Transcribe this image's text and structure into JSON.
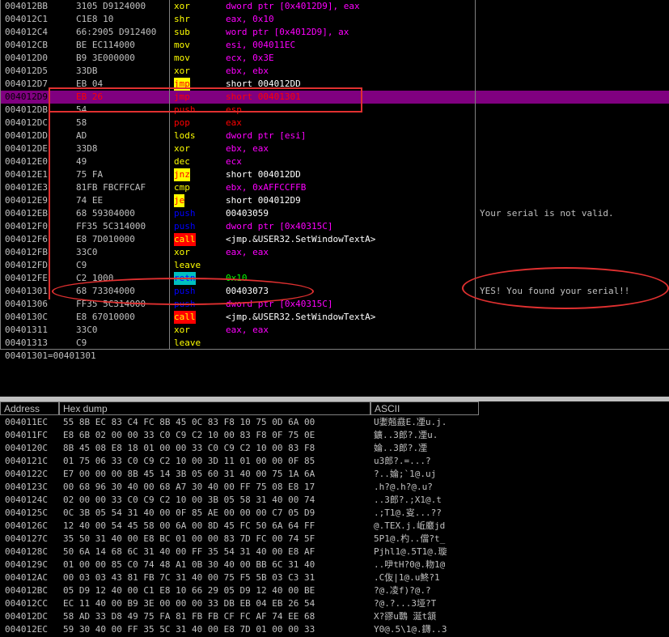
{
  "colors": {
    "selection": "#800080",
    "annotation": "#e03030",
    "jump_bg": "#ffff00",
    "call_bg": "#ff0000",
    "retn_bg": "#00c0c0"
  },
  "disasm_rows": [
    {
      "addr": "004012BB",
      "hex": "3105 D9124000",
      "mn": "xor",
      "op": "dword ptr [0x4012D9], eax",
      "mn_cls": "plain",
      "op_cls": "mixed",
      "cm": ""
    },
    {
      "addr": "004012C1",
      "hex": "C1E8 10",
      "mn": "shr",
      "op": "eax, 0x10",
      "mn_cls": "plain",
      "op_cls": "mixed",
      "cm": ""
    },
    {
      "addr": "004012C4",
      "hex": "66:2905 D912400",
      "mn": "sub",
      "op": "word ptr [0x4012D9], ax",
      "mn_cls": "plain",
      "op_cls": "mixed",
      "cm": ""
    },
    {
      "addr": "004012CB",
      "hex": "BE EC114000",
      "mn": "mov",
      "op": "esi, 004011EC",
      "mn_cls": "plain",
      "op_cls": "mixed",
      "cm": ""
    },
    {
      "addr": "004012D0",
      "hex": "B9 3E000000",
      "mn": "mov",
      "op": "ecx, 0x3E",
      "mn_cls": "plain",
      "op_cls": "mixed",
      "cm": ""
    },
    {
      "addr": "004012D5",
      "hex": "33DB",
      "mn": "xor",
      "op": "ebx, ebx",
      "mn_cls": "plain",
      "op_cls": "mixed",
      "cm": ""
    },
    {
      "addr": "004012D7",
      "hex": "EB 04",
      "mn": "jmp",
      "op": "short 004012DD",
      "mn_cls": "jump",
      "op_cls": "white",
      "cm": ""
    },
    {
      "addr": "004012D9",
      "hex": "EB 26",
      "mn": "jmp",
      "op": "short 00401301",
      "mn_cls": "red",
      "op_cls": "red",
      "cm": "",
      "sel": true
    },
    {
      "addr": "004012DB",
      "hex": "54",
      "mn": "push",
      "op": "esp",
      "mn_cls": "red",
      "op_cls": "red",
      "cm": ""
    },
    {
      "addr": "004012DC",
      "hex": "58",
      "mn": "pop",
      "op": "eax",
      "mn_cls": "red",
      "op_cls": "red",
      "cm": ""
    },
    {
      "addr": "004012DD",
      "hex": "AD",
      "mn": "lods",
      "op": "dword ptr [esi]",
      "mn_cls": "plain",
      "op_cls": "mixed",
      "cm": ""
    },
    {
      "addr": "004012DE",
      "hex": "33D8",
      "mn": "xor",
      "op": "ebx, eax",
      "mn_cls": "plain",
      "op_cls": "mixed",
      "cm": ""
    },
    {
      "addr": "004012E0",
      "hex": "49",
      "mn": "dec",
      "op": "ecx",
      "mn_cls": "plain",
      "op_cls": "mixed",
      "cm": ""
    },
    {
      "addr": "004012E1",
      "hex": "75 FA",
      "mn": "jnz",
      "op": "short 004012DD",
      "mn_cls": "jump",
      "op_cls": "white",
      "cm": ""
    },
    {
      "addr": "004012E3",
      "hex": "81FB FBCFFCAF",
      "mn": "cmp",
      "op": "ebx, 0xAFFCCFFB",
      "mn_cls": "plain",
      "op_cls": "mixed",
      "cm": ""
    },
    {
      "addr": "004012E9",
      "hex": "74 EE",
      "mn": "je",
      "op": "short 004012D9",
      "mn_cls": "jump",
      "op_cls": "white",
      "cm": ""
    },
    {
      "addr": "004012EB",
      "hex": "68 59304000",
      "mn": "push",
      "op": "00403059",
      "mn_cls": "push",
      "op_cls": "white",
      "cm": "Your serial is not valid."
    },
    {
      "addr": "004012F0",
      "hex": "FF35 5C314000",
      "mn": "push",
      "op": "dword ptr [0x40315C]",
      "mn_cls": "push",
      "op_cls": "mixed",
      "cm": ""
    },
    {
      "addr": "004012F6",
      "hex": "E8 7D010000",
      "mn": "call",
      "op": "<jmp.&USER32.SetWindowTextA>",
      "mn_cls": "call",
      "op_cls": "white",
      "cm": ""
    },
    {
      "addr": "004012FB",
      "hex": "33C0",
      "mn": "xor",
      "op": "eax, eax",
      "mn_cls": "plain",
      "op_cls": "mixed",
      "cm": ""
    },
    {
      "addr": "004012FD",
      "hex": "C9",
      "mn": "leave",
      "op": "",
      "mn_cls": "plain",
      "op_cls": "mixed",
      "cm": ""
    },
    {
      "addr": "004012FE",
      "hex": "C2 1000",
      "mn": "retn",
      "op": "0x10",
      "mn_cls": "retn",
      "op_cls": "green",
      "cm": ""
    },
    {
      "addr": "00401301",
      "hex": "68 73304000",
      "mn": "push",
      "op": "00403073",
      "mn_cls": "push",
      "op_cls": "white",
      "cm": "YES! You found your serial!!"
    },
    {
      "addr": "00401306",
      "hex": "FF35 5C314000",
      "mn": "push",
      "op": "dword ptr [0x40315C]",
      "mn_cls": "push",
      "op_cls": "mixed",
      "cm": ""
    },
    {
      "addr": "0040130C",
      "hex": "E8 67010000",
      "mn": "call",
      "op": "<jmp.&USER32.SetWindowTextA>",
      "mn_cls": "call",
      "op_cls": "white",
      "cm": ""
    },
    {
      "addr": "00401311",
      "hex": "33C0",
      "mn": "xor",
      "op": "eax, eax",
      "mn_cls": "plain",
      "op_cls": "mixed",
      "cm": ""
    },
    {
      "addr": "00401313",
      "hex": "C9",
      "mn": "leave",
      "op": "",
      "mn_cls": "plain",
      "op_cls": "mixed",
      "cm": ""
    }
  ],
  "info_line": "00401301=00401301",
  "dump_headers": {
    "address": "Address",
    "hex": "Hex dump",
    "ascii": "ASCII"
  },
  "dump_rows": [
    {
      "addr": "004011EC",
      "hex": "55 8B EC 83 C4 FC 8B 45 0C 83 F8 10 75 0D 6A 00",
      "asc": "U嬱兡鼖E.凐u.j."
    },
    {
      "addr": "004011FC",
      "hex": "E8 6B 02 00 00 33 C0 C9 C2 10 00 83 F8 0F 75 0E",
      "asc": "鑛..3郎?.凐u."
    },
    {
      "addr": "0040120C",
      "hex": "8B 45 08 E8 18 01 00 00 33 C0 C9 C2 10 00 83 F8",
      "asc": "婨..3郎?.凐"
    },
    {
      "addr": "0040121C",
      "hex": "01 75 06 33 C0 C9 C2 10 00 3D 11 01 00 00 0F 85",
      "asc": "u3郎?.=...?"
    },
    {
      "addr": "0040122C",
      "hex": "E7 00 00 00 8B 45 14 3B 05 60 31 40 00 75 1A 6A",
      "asc": "?..婨;`1@.uj"
    },
    {
      "addr": "0040123C",
      "hex": "00 68 96 30 40 00 68 A7 30 40 00 FF 75 08 E8 17",
      "asc": ".h?@.h?@.u?"
    },
    {
      "addr": "0040124C",
      "hex": "02 00 00 33 C0 C9 C2 10 00 3B 05 58 31 40 00 74",
      "asc": "..3郎?.;X1@.t"
    },
    {
      "addr": "0040125C",
      "hex": "0C 3B 05 54 31 40 00 0F 85 AE 00 00 00 C7 05 D9",
      "asc": ".;T1@.叜...??"
    },
    {
      "addr": "0040126C",
      "hex": "12 40 00 54 45 58 00 6A 00 8D 45 FC 50 6A 64 FF",
      "asc": "@.TEX.j.岴黀jd"
    },
    {
      "addr": "0040127C",
      "hex": "35 50 31 40 00 E8 BC 01 00 00 83 7D FC 00 74 5F",
      "asc": "5P1@.杓..儅?t_"
    },
    {
      "addr": "0040128C",
      "hex": "50 6A 14 68 6C 31 40 00 FF 35 54 31 40 00 E8 AF",
      "asc": "Pjhl1@.5T1@.璇"
    },
    {
      "addr": "0040129C",
      "hex": "01 00 00 85 C0 74 48 A1 0B 30 40 00 BB 6C 31 40",
      "asc": "..吚tH?0@.粅1@"
    },
    {
      "addr": "004012AC",
      "hex": "00 03 03 43 81 FB 7C 31 40 00 75 F5 5B 03 C3 31",
      "asc": ".C伖|1@.u鮗?1"
    },
    {
      "addr": "004012BC",
      "hex": "05 D9 12 40 00 C1 E8 10 66 29 05 D9 12 40 00 BE",
      "asc": "?@.凌f)?@.?"
    },
    {
      "addr": "004012CC",
      "hex": "EC 11 40 00 B9 3E 00 00 00 33 DB EB 04 EB 26 54",
      "asc": "?@.?...3垭?T"
    },
    {
      "addr": "004012DC",
      "hex": "58 AD 33 D8 49 75 FA 81 FB FB CF FC AF 74 EE 68",
      "asc": "X?豂u鷣 涎t頷"
    },
    {
      "addr": "004012EC",
      "hex": "59 30 40 00 FF 35 5C 31 40 00 E8 7D 01 00 00 33",
      "asc": "Y0@.5\\1@.鑮..3"
    }
  ]
}
